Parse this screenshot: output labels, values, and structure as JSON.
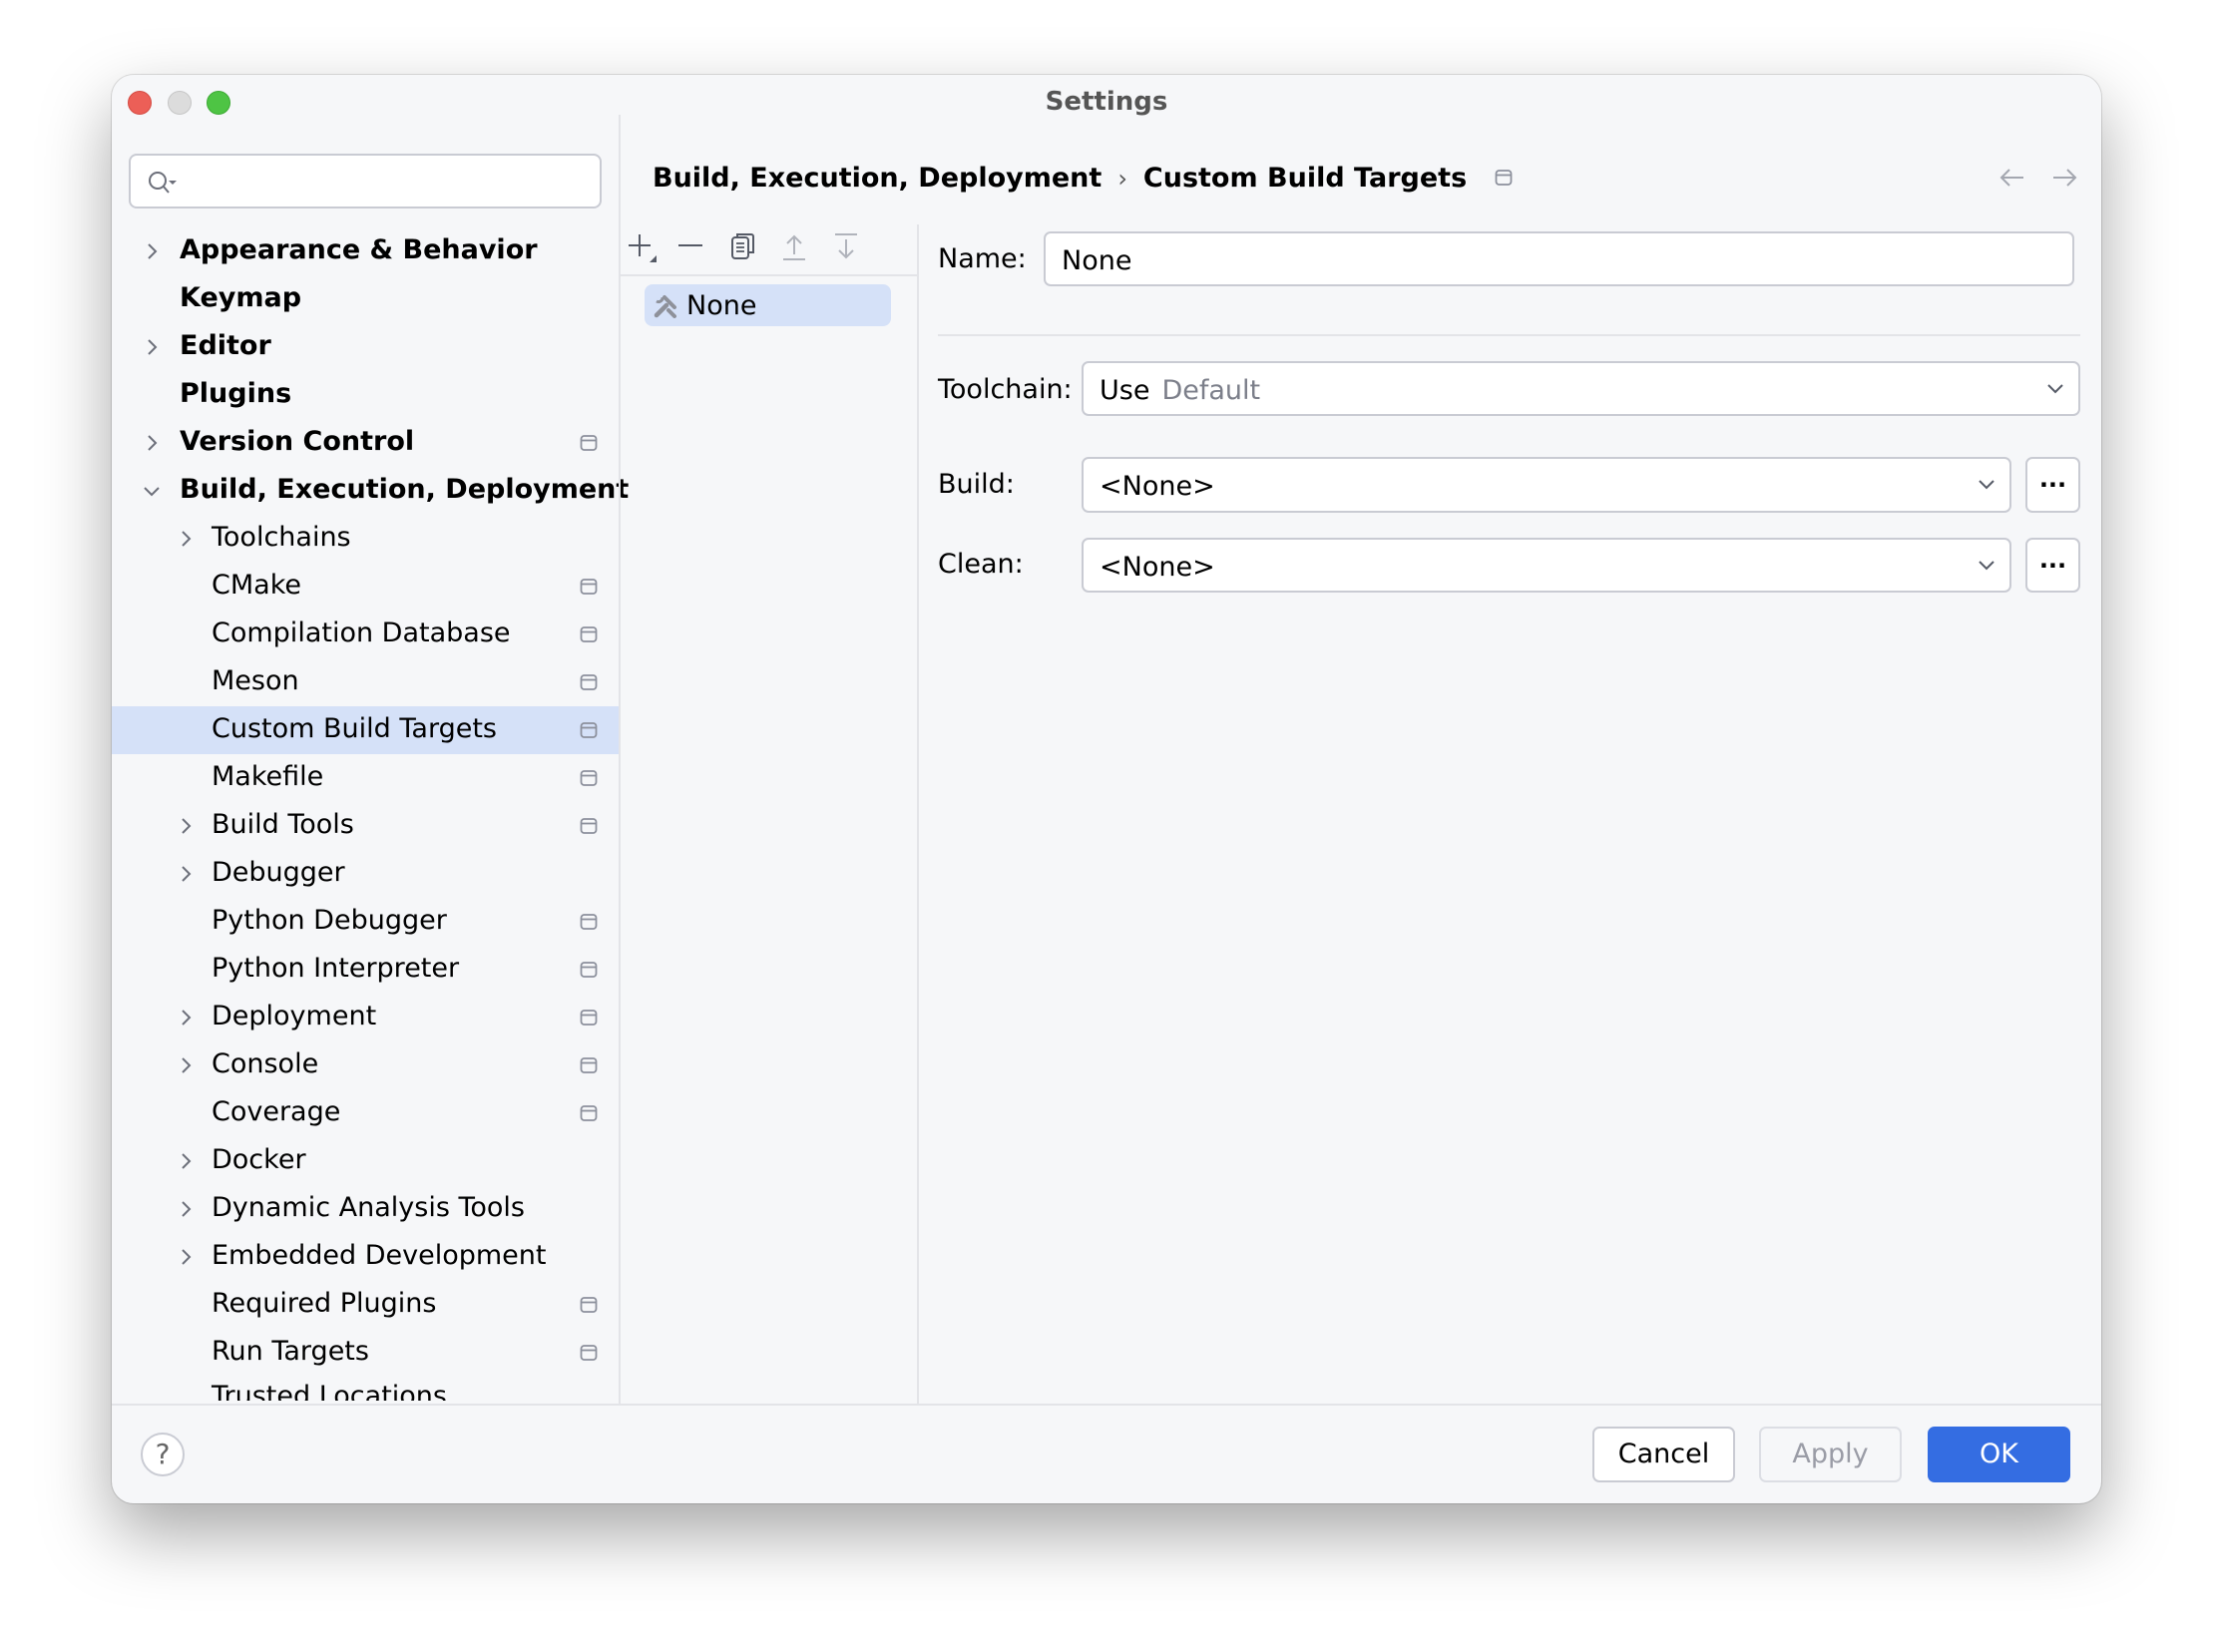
{
  "window": {
    "title": "Settings"
  },
  "search": {
    "placeholder": "",
    "value": ""
  },
  "sidebar": {
    "items": [
      {
        "label": "Appearance & Behavior",
        "level": 0,
        "chevron": "right",
        "bold": true,
        "card": false
      },
      {
        "label": "Keymap",
        "level": 0,
        "chevron": "none",
        "bold": true,
        "card": false
      },
      {
        "label": "Editor",
        "level": 0,
        "chevron": "right",
        "bold": true,
        "card": false
      },
      {
        "label": "Plugins",
        "level": 0,
        "chevron": "none",
        "bold": true,
        "card": false
      },
      {
        "label": "Version Control",
        "level": 0,
        "chevron": "right",
        "bold": true,
        "card": true
      },
      {
        "label": "Build, Execution, Deployment",
        "level": 0,
        "chevron": "down",
        "bold": true,
        "card": false
      },
      {
        "label": "Toolchains",
        "level": 1,
        "chevron": "right",
        "bold": false,
        "card": false
      },
      {
        "label": "CMake",
        "level": 1,
        "chevron": "none",
        "bold": false,
        "card": true
      },
      {
        "label": "Compilation Database",
        "level": 1,
        "chevron": "none",
        "bold": false,
        "card": true
      },
      {
        "label": "Meson",
        "level": 1,
        "chevron": "none",
        "bold": false,
        "card": true
      },
      {
        "label": "Custom Build Targets",
        "level": 1,
        "chevron": "none",
        "bold": false,
        "card": true,
        "selected": true
      },
      {
        "label": "Makefile",
        "level": 1,
        "chevron": "none",
        "bold": false,
        "card": true
      },
      {
        "label": "Build Tools",
        "level": 1,
        "chevron": "right",
        "bold": false,
        "card": true
      },
      {
        "label": "Debugger",
        "level": 1,
        "chevron": "right",
        "bold": false,
        "card": false
      },
      {
        "label": "Python Debugger",
        "level": 1,
        "chevron": "none",
        "bold": false,
        "card": true
      },
      {
        "label": "Python Interpreter",
        "level": 1,
        "chevron": "none",
        "bold": false,
        "card": true
      },
      {
        "label": "Deployment",
        "level": 1,
        "chevron": "right",
        "bold": false,
        "card": true
      },
      {
        "label": "Console",
        "level": 1,
        "chevron": "right",
        "bold": false,
        "card": true
      },
      {
        "label": "Coverage",
        "level": 1,
        "chevron": "none",
        "bold": false,
        "card": true
      },
      {
        "label": "Docker",
        "level": 1,
        "chevron": "right",
        "bold": false,
        "card": false
      },
      {
        "label": "Dynamic Analysis Tools",
        "level": 1,
        "chevron": "right",
        "bold": false,
        "card": false
      },
      {
        "label": "Embedded Development",
        "level": 1,
        "chevron": "right",
        "bold": false,
        "card": false
      },
      {
        "label": "Required Plugins",
        "level": 1,
        "chevron": "none",
        "bold": false,
        "card": true
      },
      {
        "label": "Run Targets",
        "level": 1,
        "chevron": "none",
        "bold": false,
        "card": true
      },
      {
        "label": "Trusted Locations",
        "level": 1,
        "chevron": "none",
        "bold": false,
        "card": false,
        "clipped": true
      }
    ]
  },
  "breadcrumb": {
    "parent": "Build, Execution, Deployment",
    "separator": "›",
    "current": "Custom Build Targets"
  },
  "list_toolbar": {
    "icons": [
      "add-icon",
      "remove-icon",
      "copy-icon",
      "move-up-icon",
      "move-down-icon"
    ]
  },
  "targets": [
    {
      "label": "None",
      "icon": "build-tools-icon",
      "selected": true
    }
  ],
  "form": {
    "name_label": "Name:",
    "name_value": "None",
    "toolchain_label": "Toolchain:",
    "toolchain_prefix": "Use",
    "toolchain_value": "Default",
    "build_label": "Build:",
    "build_value": "<None>",
    "clean_label": "Clean:",
    "clean_value": "<None>",
    "browse_label": "..."
  },
  "footer": {
    "help": "?",
    "cancel": "Cancel",
    "apply": "Apply",
    "ok": "OK"
  },
  "colors": {
    "accent": "#346de2",
    "selection": "#d5e1f8",
    "background": "#f6f7f9"
  }
}
